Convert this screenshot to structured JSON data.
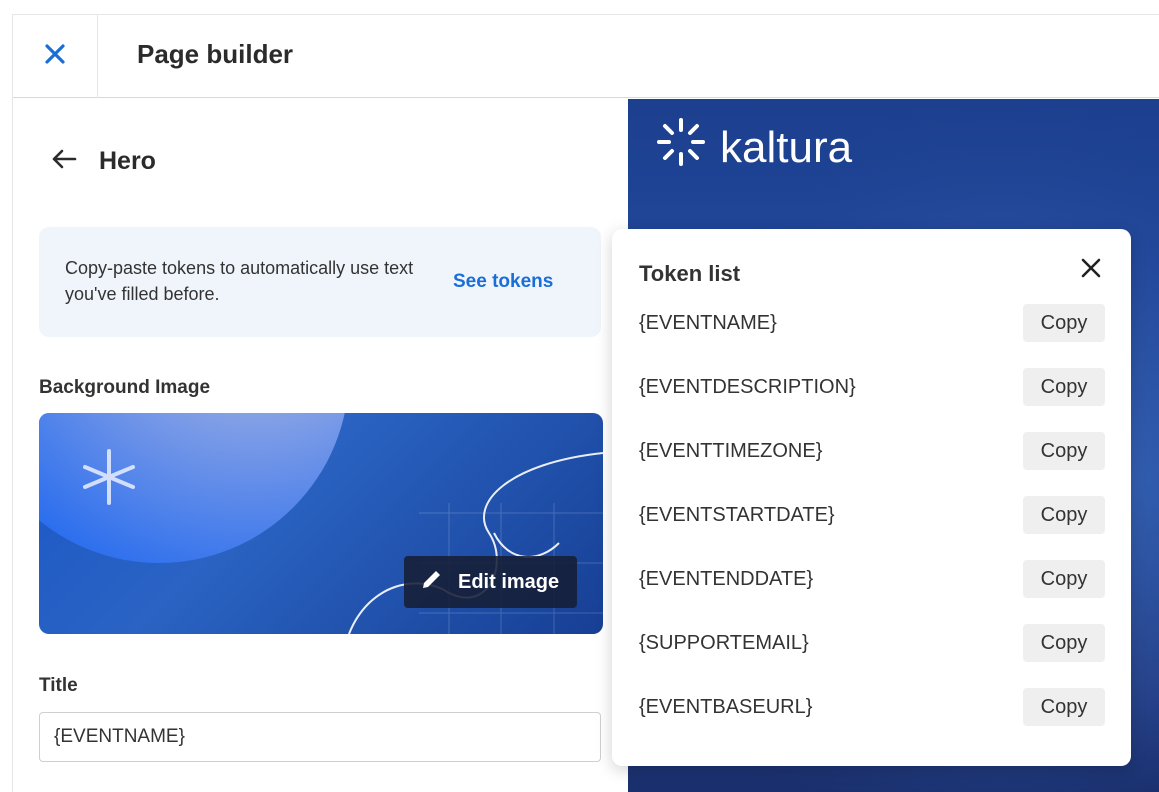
{
  "header": {
    "title": "Page builder"
  },
  "panel": {
    "section_title": "Hero",
    "info": {
      "text": "Copy-paste tokens to automatically use text you've filled before.",
      "link": "See tokens"
    },
    "background_image": {
      "label": "Background Image",
      "edit_button": "Edit image"
    },
    "title_field": {
      "label": "Title",
      "value": "{EVENTNAME}"
    }
  },
  "preview": {
    "logo_text": "kaltura"
  },
  "token_list": {
    "title": "Token list",
    "tokens": [
      {
        "name": "{EVENTNAME}",
        "action": "Copy"
      },
      {
        "name": "{EVENTDESCRIPTION}",
        "action": "Copy"
      },
      {
        "name": "{EVENTTIMEZONE}",
        "action": "Copy"
      },
      {
        "name": "{EVENTSTARTDATE}",
        "action": "Copy"
      },
      {
        "name": "{EVENTENDDATE}",
        "action": "Copy"
      },
      {
        "name": "{SUPPORTEMAIL}",
        "action": "Copy"
      },
      {
        "name": "{EVENTBASEURL}",
        "action": "Copy"
      }
    ]
  },
  "colors": {
    "accent": "#1a6ed8",
    "preview_bg": "#22479a"
  },
  "icons": [
    "close-icon",
    "arrow-left-icon",
    "pencil-icon",
    "kaltura-logo-icon",
    "asterisk-icon"
  ]
}
